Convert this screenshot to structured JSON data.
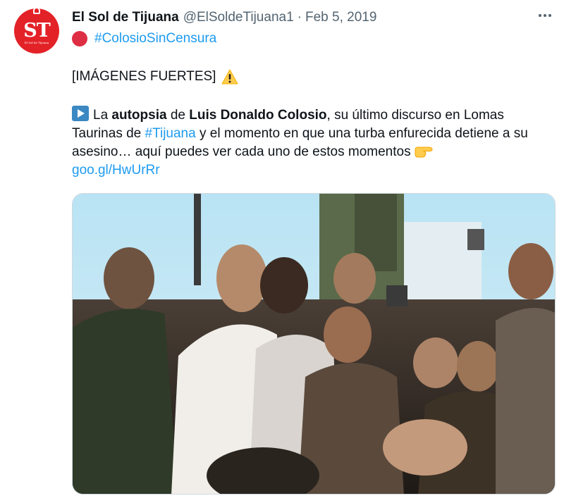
{
  "tweet": {
    "author_name": "El Sol de Tijuana",
    "author_handle": "@ElSoldeTijuana1",
    "separator": "·",
    "date": "Feb 5, 2019",
    "avatar_text": "ST",
    "avatar_subtext": "El Sol de Tijuana",
    "hashtag_line": "#ColosioSinCensura",
    "warning_line": "[IMÁGENES FUERTES]",
    "body": {
      "part1": "La ",
      "bold1": "autopsia",
      "part2": " de ",
      "bold2": "Luis Donaldo Colosio",
      "part3": ", su último discurso en Lomas Taurinas de ",
      "hashtag": "#Tijuana",
      "part4": " y el momento en que una turba enfurecida detiene a su asesino… aquí puedes ver cada uno de estos momentos"
    },
    "link": "goo.gl/HwUrRr",
    "icons": {
      "more": "more-dots-icon",
      "red_circle": "red-circle-emoji",
      "warning": "warning-emoji",
      "play": "play-button-emoji",
      "point": "pointing-hand-emoji"
    },
    "colors": {
      "link": "#1d9bf0",
      "text": "#0f1419",
      "secondary": "#536471",
      "brand_red": "#e32228"
    }
  }
}
